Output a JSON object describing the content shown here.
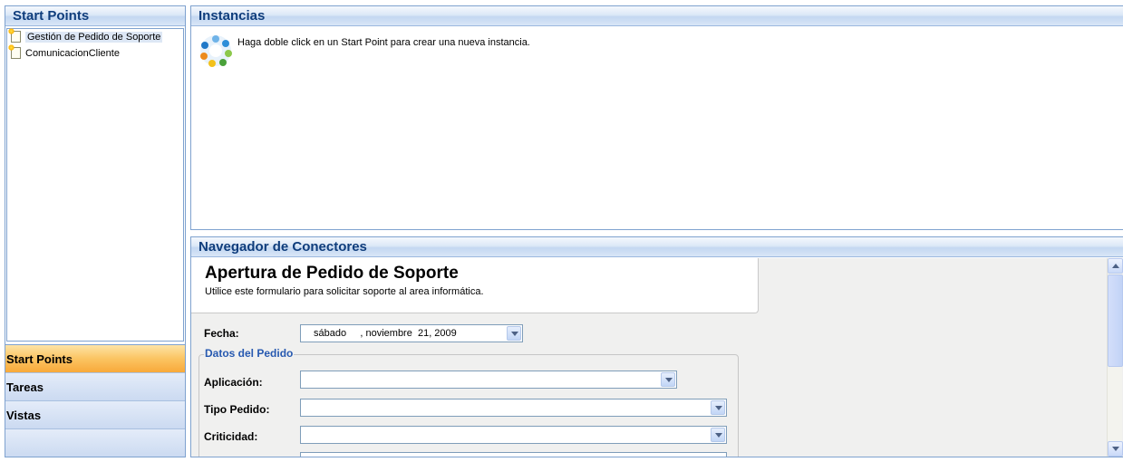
{
  "left": {
    "title": "Start Points",
    "tree": [
      {
        "label": "Gestión de Pedido de Soporte",
        "selected": true
      },
      {
        "label": "ComunicacionCliente",
        "selected": false
      }
    ],
    "nav_buttons": [
      {
        "label": "Start Points",
        "active": true
      },
      {
        "label": "Tareas",
        "active": false
      },
      {
        "label": "Vistas",
        "active": false
      }
    ]
  },
  "instancias": {
    "title": "Instancias",
    "hint": "Haga doble click en un Start Point para crear una nueva instancia."
  },
  "navegador": {
    "title": "Navegador de Conectores",
    "form_title": "Apertura de Pedido de Soporte",
    "form_subtitle": "Utilice este formulario para solicitar soporte al area informática.",
    "fecha_label": "Fecha:",
    "fecha_value": "sábado     , noviembre  21, 2009",
    "section_label": "Datos del Pedido",
    "fields": [
      {
        "label": "Aplicación:",
        "value": ""
      },
      {
        "label": "Tipo Pedido:",
        "value": ""
      },
      {
        "label": "Criticidad:",
        "value": ""
      }
    ]
  }
}
